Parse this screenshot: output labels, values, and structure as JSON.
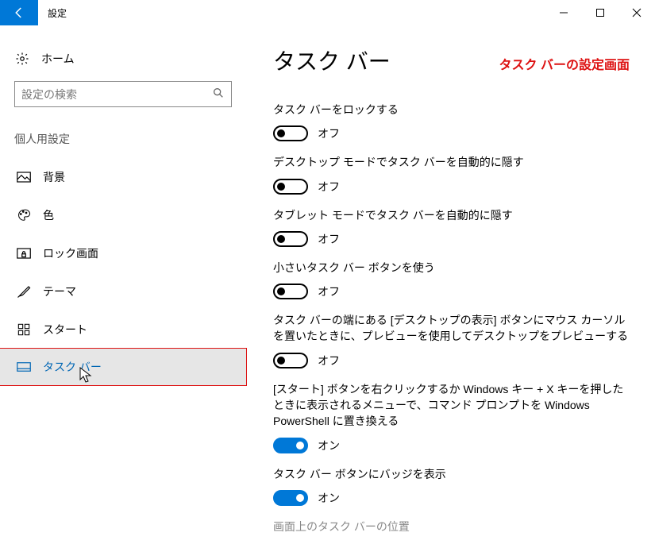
{
  "titlebar": {
    "title": "設定"
  },
  "sidebar": {
    "home": "ホーム",
    "search_placeholder": "設定の検索",
    "section_label": "個人用設定",
    "items": [
      {
        "label": "背景"
      },
      {
        "label": "色"
      },
      {
        "label": "ロック画面"
      },
      {
        "label": "テーマ"
      },
      {
        "label": "スタート"
      },
      {
        "label": "タスク バー"
      }
    ]
  },
  "content": {
    "title": "タスク バー",
    "red_note": "タスク バーの設定画面",
    "settings": [
      {
        "label": "タスク バーをロックする",
        "state": "off",
        "state_label": "オフ"
      },
      {
        "label": "デスクトップ モードでタスク バーを自動的に隠す",
        "state": "off",
        "state_label": "オフ"
      },
      {
        "label": "タブレット モードでタスク バーを自動的に隠す",
        "state": "off",
        "state_label": "オフ"
      },
      {
        "label": "小さいタスク バー ボタンを使う",
        "state": "off",
        "state_label": "オフ"
      },
      {
        "label": "タスク バーの端にある [デスクトップの表示] ボタンにマウス カーソルを置いたときに、プレビューを使用してデスクトップをプレビューする",
        "state": "off",
        "state_label": "オフ"
      },
      {
        "label": "[スタート] ボタンを右クリックするか Windows キー + X キーを押したときに表示されるメニューで、コマンド プロンプトを Windows PowerShell に置き換える",
        "state": "on",
        "state_label": "オン"
      },
      {
        "label": "タスク バー ボタンにバッジを表示",
        "state": "on",
        "state_label": "オン"
      }
    ],
    "cutoff_label": "画面上のタスク バーの位置"
  }
}
